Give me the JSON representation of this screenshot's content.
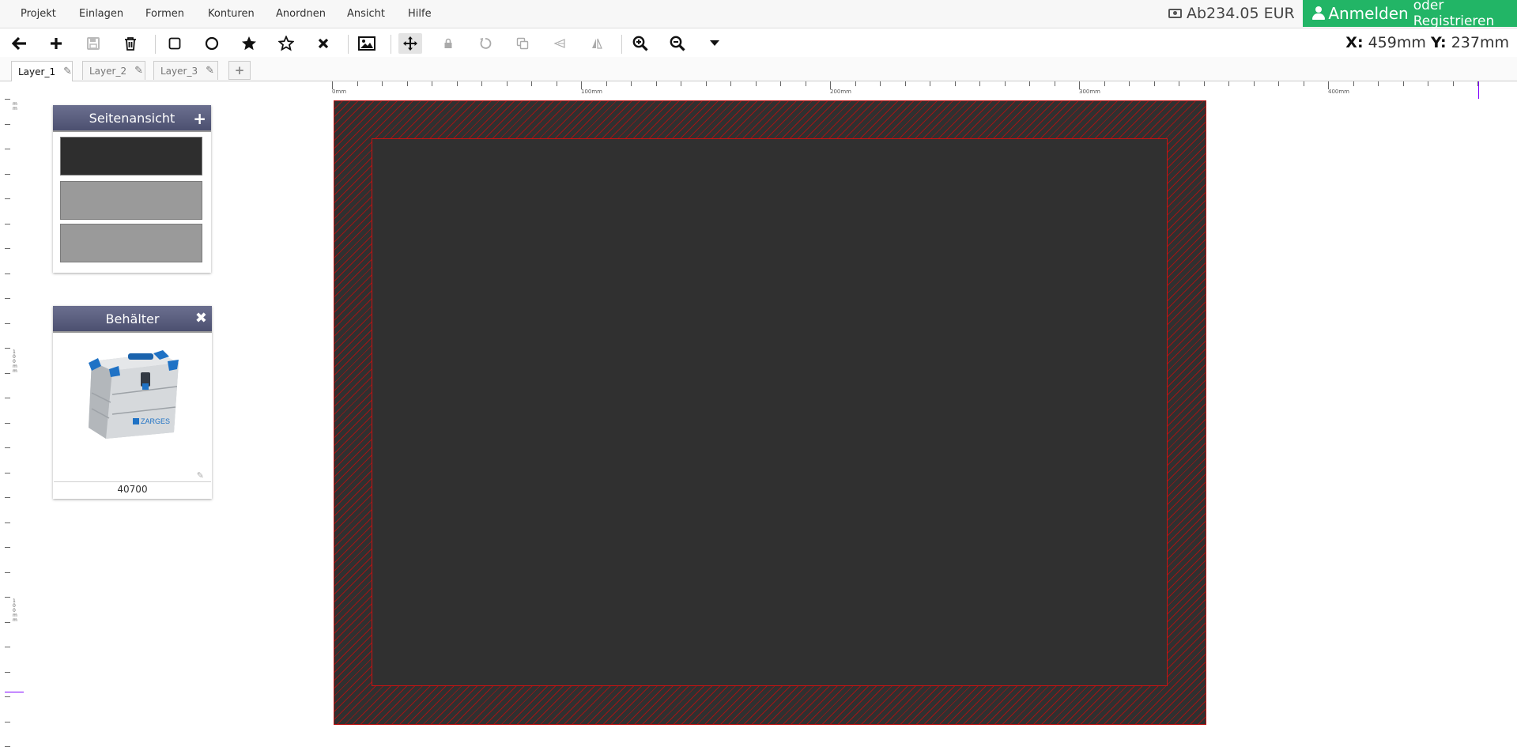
{
  "menu": {
    "items": [
      "Projekt",
      "Einlagen",
      "Formen",
      "Konturen",
      "Anordnen",
      "Ansicht",
      "Hilfe"
    ]
  },
  "price": {
    "text": "Ab234.05 EUR",
    "icon": "money-icon"
  },
  "login": {
    "main": "Anmelden",
    "sub": "oder Registrieren",
    "color": "#22b566"
  },
  "toolbar": {
    "tools": [
      {
        "icon": "back-arrow-icon",
        "enabled": true
      },
      {
        "icon": "plus-icon",
        "enabled": true
      },
      {
        "icon": "save-icon",
        "enabled": false
      },
      {
        "icon": "trash-icon",
        "enabled": true
      },
      {
        "icon": "rectangle-icon",
        "enabled": true
      },
      {
        "icon": "circle-icon",
        "enabled": true
      },
      {
        "icon": "star-filled-icon",
        "enabled": true
      },
      {
        "icon": "star-outline-icon",
        "enabled": true
      },
      {
        "icon": "cross-icon",
        "enabled": true
      },
      {
        "icon": "image-icon",
        "enabled": true
      },
      {
        "icon": "move-icon",
        "enabled": true,
        "active": true
      },
      {
        "icon": "lock-icon",
        "enabled": false
      },
      {
        "icon": "rotate-icon",
        "enabled": false
      },
      {
        "icon": "duplicate-icon",
        "enabled": false
      },
      {
        "icon": "flip-horizontal-icon",
        "enabled": false
      },
      {
        "icon": "flip-vertical-icon",
        "enabled": false
      },
      {
        "icon": "zoom-in-icon",
        "enabled": true
      },
      {
        "icon": "zoom-out-icon",
        "enabled": true
      },
      {
        "icon": "caret-down-icon",
        "enabled": true
      }
    ],
    "coords": {
      "x_label": "X:",
      "x_value": "459mm",
      "y_label": "Y:",
      "y_value": "237mm"
    }
  },
  "layers": {
    "tabs": [
      "Layer_1",
      "Layer_2",
      "Layer_3"
    ],
    "active": "Layer_1"
  },
  "ruler": {
    "h_labels": [
      "0mm",
      "100mm",
      "200mm",
      "300mm",
      "400mm"
    ],
    "v_labels": [
      "mm",
      "100mm",
      "100mm"
    ]
  },
  "side_panel": {
    "title": "Seitenansicht",
    "swatches": [
      "#2e2e2e",
      "#9a9a9a",
      "#9a9a9a"
    ]
  },
  "container_panel": {
    "title": "Behälter",
    "product_brand": "ZARGES",
    "item_number": "40700"
  },
  "canvas": {
    "fill": "#303030",
    "border_color": "#cc1111"
  }
}
